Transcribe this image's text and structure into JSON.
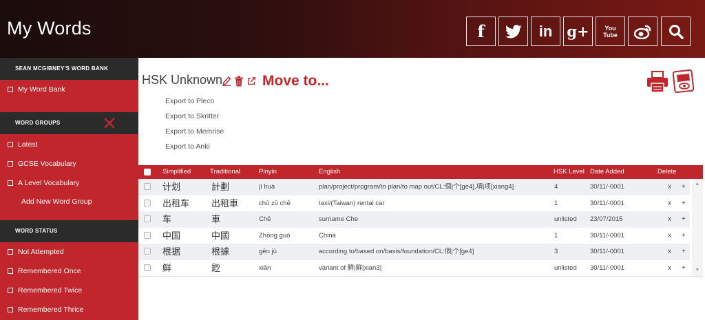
{
  "header": {
    "title": "My Words",
    "social": [
      {
        "icon": "facebook-icon",
        "glyph": "f"
      },
      {
        "icon": "twitter-icon",
        "glyph": ""
      },
      {
        "icon": "linkedin-icon",
        "glyph": "in"
      },
      {
        "icon": "google-plus-icon",
        "glyph": "g+"
      },
      {
        "icon": "youtube-icon",
        "glyph": "You Tube"
      },
      {
        "icon": "weibo-icon",
        "glyph": ""
      },
      {
        "icon": "search-icon",
        "glyph": ""
      }
    ]
  },
  "sidebar": {
    "word_bank_heading": "SEAN MCGIBNEY'S WORD BANK",
    "word_bank_item": "My Word Bank",
    "groups_heading": "WORD GROUPS",
    "groups": [
      "Latest",
      "GCSE Vocabulary",
      "A Level Vocabulary"
    ],
    "add_group": "Add New Word Group",
    "status_heading": "WORD STATUS",
    "statuses": [
      "Not Attempted",
      "Remembered Once",
      "Remembered Twice",
      "Remembered Thrice"
    ]
  },
  "main": {
    "title": "HSK Unknown",
    "move_to": "Move to...",
    "exports": [
      "Export to Pleco",
      "Export to Skritter",
      "Export to Memrise",
      "Export to Anki"
    ]
  },
  "table": {
    "columns": {
      "simplified": "Simplified",
      "traditional": "Traditional",
      "pinyin": "Pinyin",
      "english": "English",
      "hsk": "HSK Level",
      "date": "Date Added",
      "delete": "Delete"
    },
    "rows": [
      {
        "simplified": "计划",
        "traditional": "計劃",
        "pinyin": "jì huà",
        "english": "plan/project/program/to plan/to map out/CL:個|个[ge4],項|项[xiang4]",
        "hsk": "4",
        "date": "30/11/-0001"
      },
      {
        "simplified": "出租车",
        "traditional": "出租車",
        "pinyin": "chū zū chē",
        "english": "taxi/(Taiwan) rental car",
        "hsk": "1",
        "date": "30/11/-0001"
      },
      {
        "simplified": "车",
        "traditional": "車",
        "pinyin": "Chē",
        "english": "surname Che",
        "hsk": "unlisted",
        "date": "23/07/2015"
      },
      {
        "simplified": "中国",
        "traditional": "中國",
        "pinyin": "Zhōng guó",
        "english": "China",
        "hsk": "1",
        "date": "30/11/-0001"
      },
      {
        "simplified": "根据",
        "traditional": "根據",
        "pinyin": "gēn jù",
        "english": "according to/based on/basis/foundation/CL:個|个[ge4]",
        "hsk": "3",
        "date": "30/11/-0001"
      },
      {
        "simplified": "鲜",
        "traditional": "尟",
        "pinyin": "xiān",
        "english": "variant of 鮮|鲜[xian3]",
        "hsk": "unlisted",
        "date": "30/11/-0001"
      }
    ],
    "delete_x": "x",
    "add_plus": "+"
  },
  "colors": {
    "brand_red": "#c1262d",
    "dark_bar": "#2b2b2b",
    "row_alt": "#eef0f3"
  }
}
